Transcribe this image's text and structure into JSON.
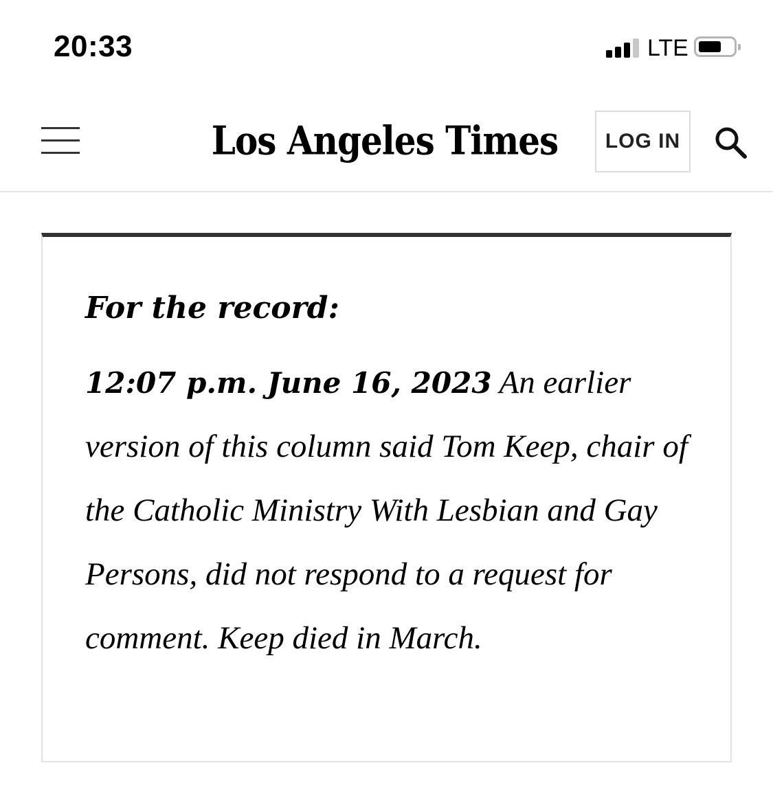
{
  "status_bar": {
    "time": "20:33",
    "network": "LTE",
    "signal_bars_active": 3,
    "signal_bars_total": 4,
    "battery_level_percent": 60
  },
  "header": {
    "logo_text": "Los Angeles Times",
    "login_label": "LOG IN",
    "menu_icon": "hamburger-menu-icon",
    "search_icon": "search-icon"
  },
  "correction": {
    "heading": "For the record:",
    "timestamp": "12:07 p.m. June 16, 2023",
    "text": "An earlier version of this column said Tom Keep, chair of the Catholic Ministry With Lesbian and Gay Persons, did not respond to a request for comment. Keep died in March."
  },
  "colors": {
    "card_top_rule": "#333333",
    "card_border": "#e2e2e2",
    "header_divider": "#e4e4e4"
  }
}
